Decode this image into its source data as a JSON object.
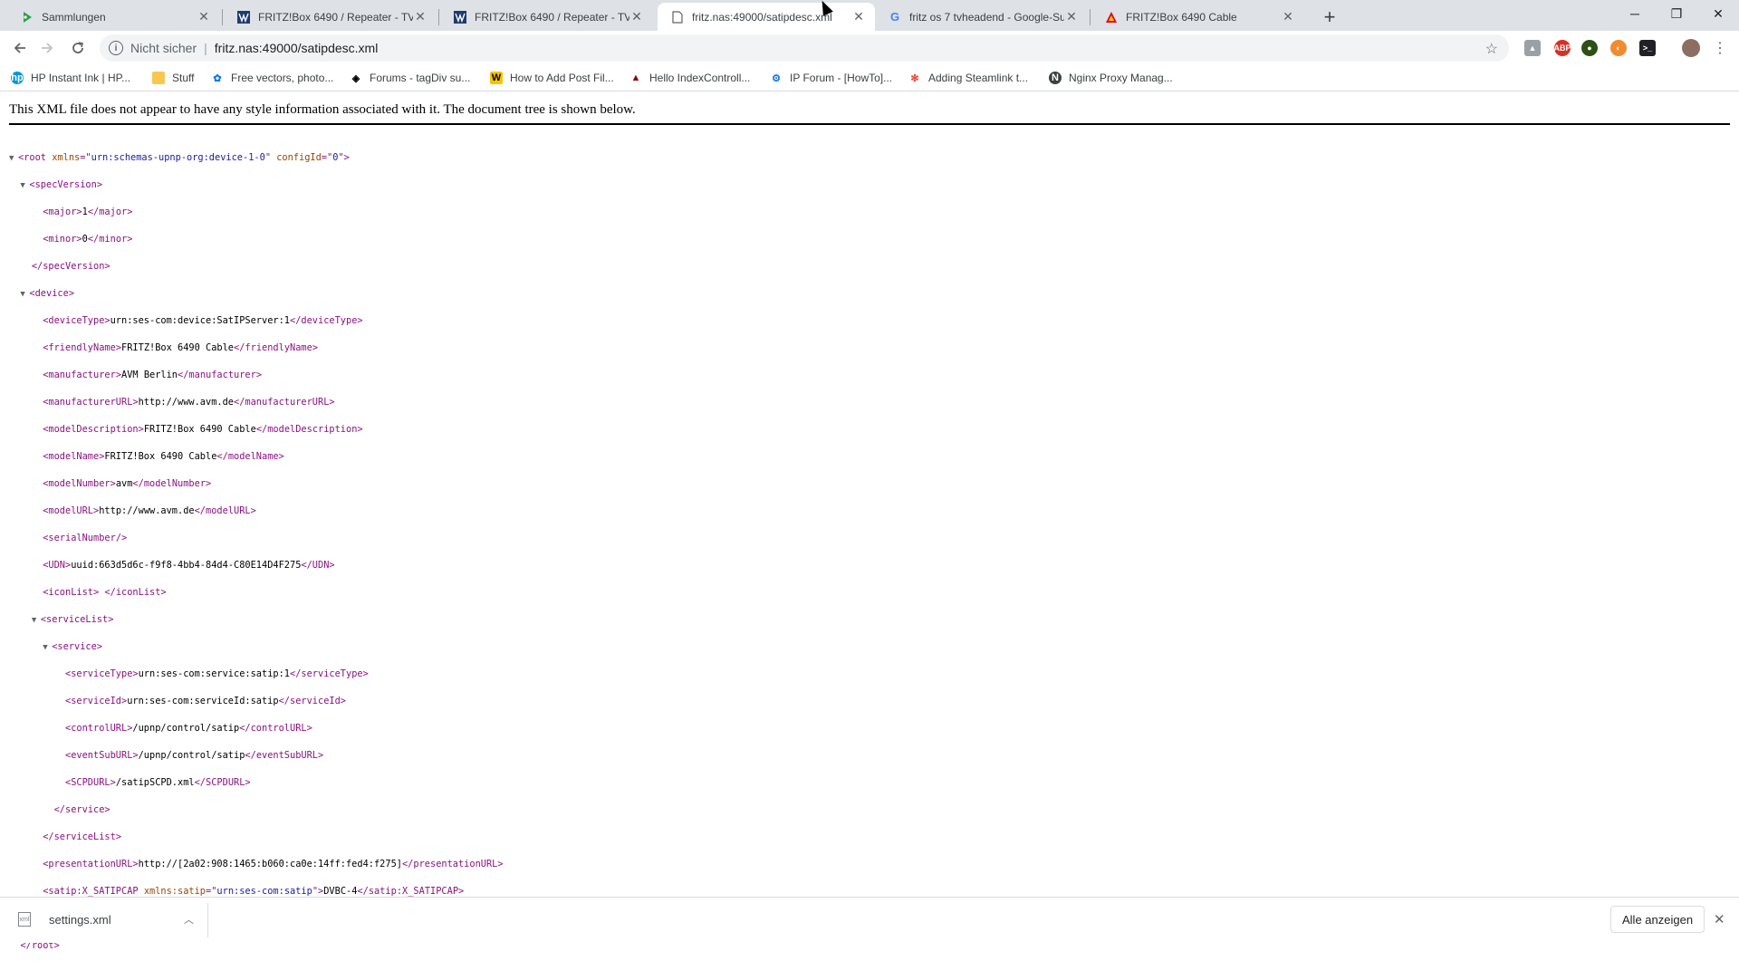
{
  "tabs": [
    {
      "title": "Sammlungen",
      "icon": "sammlungen-icon",
      "active": false
    },
    {
      "title": "FRITZ!Box 6490 / Repeater - TVH",
      "icon": "site-favicon-icon",
      "active": false
    },
    {
      "title": "FRITZ!Box 6490 / Repeater - TVH",
      "icon": "site-favicon-icon",
      "active": false
    },
    {
      "title": "fritz.nas:49000/satipdesc.xml",
      "icon": "document-icon",
      "active": true
    },
    {
      "title": "fritz os 7 tvheadend - Google-Su",
      "icon": "google-icon",
      "active": false
    },
    {
      "title": "FRITZ!Box 6490 Cable",
      "icon": "fritzbox-icon",
      "active": false
    }
  ],
  "toolbar": {
    "security_label": "Nicht sicher",
    "url": "fritz.nas:49000/satipdesc.xml"
  },
  "bookmarks": [
    {
      "label": "HP Instant Ink | HP...",
      "icon": "hp-icon"
    },
    {
      "label": "Stuff",
      "icon": "folder-icon"
    },
    {
      "label": "Free vectors, photo...",
      "icon": "freepik-icon"
    },
    {
      "label": "Forums - tagDiv su...",
      "icon": "tagdiv-icon"
    },
    {
      "label": "How to Add Post Fil...",
      "icon": "wp-plugin-icon"
    },
    {
      "label": "Hello IndexControll...",
      "icon": "indexcontroller-icon"
    },
    {
      "label": "IP Forum - [HowTo]...",
      "icon": "ipforum-icon"
    },
    {
      "label": "Adding Steamlink t...",
      "icon": "steamlink-icon"
    },
    {
      "label": "Nginx Proxy Manag...",
      "icon": "nginx-icon"
    }
  ],
  "notice": "This XML file does not appear to have any style information associated with it. The document tree is shown below.",
  "xml": {
    "root_open": {
      "tag": "root",
      "attrs": [
        {
          "n": "xmlns",
          "v": "urn:schemas-upnp-org:device-1-0"
        },
        {
          "n": "configId",
          "v": "0"
        }
      ]
    },
    "specVersion": "specVersion",
    "major": {
      "tag": "major",
      "value": "1"
    },
    "minor": {
      "tag": "minor",
      "value": "0"
    },
    "device": "device",
    "deviceType": {
      "tag": "deviceType",
      "value": "urn:ses-com:device:SatIPServer:1"
    },
    "friendlyName": {
      "tag": "friendlyName",
      "value": "FRITZ!Box 6490 Cable"
    },
    "manufacturer": {
      "tag": "manufacturer",
      "value": "AVM Berlin"
    },
    "manufacturerURL": {
      "tag": "manufacturerURL",
      "value": "http://www.avm.de"
    },
    "modelDescription": {
      "tag": "modelDescription",
      "value": "FRITZ!Box 6490 Cable"
    },
    "modelName": {
      "tag": "modelName",
      "value": "FRITZ!Box 6490 Cable"
    },
    "modelNumber": {
      "tag": "modelNumber",
      "value": "avm"
    },
    "modelURL": {
      "tag": "modelURL",
      "value": "http://www.avm.de"
    },
    "serialNumber": "serialNumber",
    "UDN": {
      "tag": "UDN",
      "value": "uuid:663d5d6c-f9f8-4bb4-84d4-C80E14D4F275"
    },
    "iconList": {
      "tag": "iconList",
      "value": " "
    },
    "serviceList": "serviceList",
    "service": "service",
    "serviceType": {
      "tag": "serviceType",
      "value": "urn:ses-com:service:satip:1"
    },
    "serviceId": {
      "tag": "serviceId",
      "value": "urn:ses-com:serviceId:satip"
    },
    "controlURL": {
      "tag": "controlURL",
      "value": "/upnp/control/satip"
    },
    "eventSubURL": {
      "tag": "eventSubURL",
      "value": "/upnp/control/satip"
    },
    "SCPDURL": {
      "tag": "SCPDURL",
      "value": "/satipSCPD.xml"
    },
    "presentationURL": {
      "tag": "presentationURL",
      "value": "http://[2a02:908:1465:b060:ca0e:14ff:fed4:f275]"
    },
    "satcap": {
      "tag": "satip:X_SATIPCAP",
      "attr_name": "xmlns:satip",
      "attr_value": "urn:ses-com:satip",
      "value": "DVBC-4"
    }
  },
  "download": {
    "filename": "settings.xml"
  },
  "shelf": {
    "show_all": "Alle anzeigen"
  },
  "colors": {
    "tag": "#881280",
    "attr_name": "#994500",
    "attr_value": "#1a1aa6"
  }
}
